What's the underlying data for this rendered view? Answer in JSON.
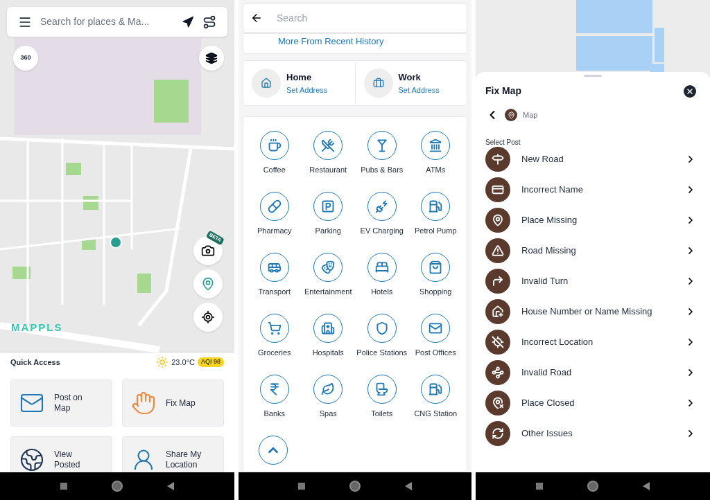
{
  "map_screen": {
    "search": {
      "placeholder": "Search for places & Ma..."
    },
    "view_360": "360",
    "camera_badge": "BETA",
    "logo": "MAPPLS",
    "quick_access": {
      "title": "Quick Access",
      "temperature": "23.0°C",
      "aqi": "AQI 98",
      "cards": [
        {
          "label": "Post on Map",
          "color": "#1f78b4"
        },
        {
          "label": "Fix Map",
          "color": "#f0883e"
        },
        {
          "label": "View Posted",
          "color": "#1d3557"
        },
        {
          "label": "Share My Location",
          "color": "#1f78b4"
        }
      ]
    }
  },
  "search_screen": {
    "search": {
      "placeholder": "Search"
    },
    "recent_link": "More From Recent History",
    "places": [
      {
        "title": "Home",
        "action": "Set Address"
      },
      {
        "title": "Work",
        "action": "Set Address"
      }
    ],
    "categories": [
      {
        "label": "Coffee"
      },
      {
        "label": "Restaurant"
      },
      {
        "label": "Pubs & Bars"
      },
      {
        "label": "ATMs"
      },
      {
        "label": "Pharmacy"
      },
      {
        "label": "Parking"
      },
      {
        "label": "EV Charging"
      },
      {
        "label": "Petrol Pump"
      },
      {
        "label": "Transport"
      },
      {
        "label": "Entertainment"
      },
      {
        "label": "Hotels"
      },
      {
        "label": "Shopping"
      },
      {
        "label": "Groceries"
      },
      {
        "label": "Hospitals"
      },
      {
        "label": "Police Stations"
      },
      {
        "label": "Post Offices"
      },
      {
        "label": "Banks"
      },
      {
        "label": "Spas"
      },
      {
        "label": "Toilets"
      },
      {
        "label": "CNG Station"
      }
    ]
  },
  "fix_map_screen": {
    "title": "Fix Map",
    "breadcrumb": "Map",
    "section": "Select Post",
    "items": [
      {
        "label": "New Road"
      },
      {
        "label": "Incorrect Name"
      },
      {
        "label": "Place Missing"
      },
      {
        "label": "Road Missing"
      },
      {
        "label": "Invalid Turn"
      },
      {
        "label": "House Number or Name Missing"
      },
      {
        "label": "Incorrect Location"
      },
      {
        "label": "Invalid Road"
      },
      {
        "label": "Place Closed"
      },
      {
        "label": "Other Issues"
      }
    ]
  }
}
